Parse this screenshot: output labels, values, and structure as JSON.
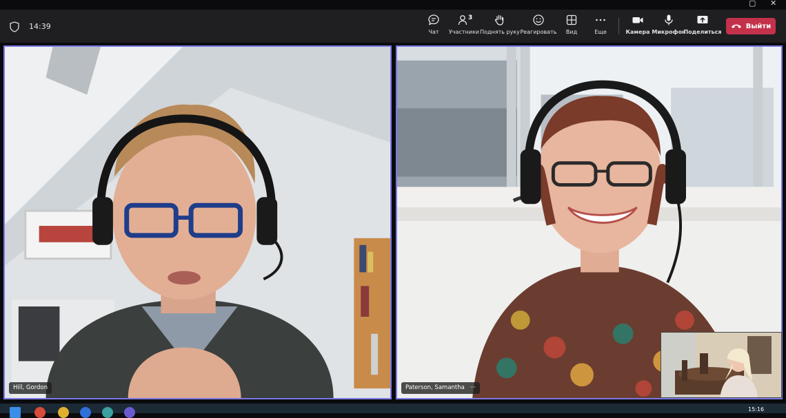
{
  "meeting": {
    "elapsed_time": "14:39"
  },
  "toolbar": {
    "chat_label": "Чат",
    "participants_label": "Участники",
    "participants_count": "3",
    "raise_hand_label": "Поднять руку",
    "react_label": "Реагировать",
    "view_label": "Вид",
    "more_label": "Еще",
    "camera_label": "Камера",
    "mic_label": "Микрофон",
    "share_label": "Поделиться",
    "leave_label": "Выйти",
    "leave_color": "#c4314b"
  },
  "participants": {
    "left_name": "Hill, Gordon",
    "right_name": "Paterson, Samantha",
    "tile_border_color": "#7a78e6"
  },
  "taskbar": {
    "clock": "15:16"
  },
  "icons": {
    "shield": "shield-icon",
    "chat": "chat-icon",
    "participants": "people-icon",
    "raise_hand": "hand-icon",
    "react": "smiley-icon",
    "view": "grid-icon",
    "more": "ellipsis-icon",
    "camera": "camera-icon",
    "mic": "mic-icon",
    "share": "share-icon",
    "leave": "phone-hangup-icon"
  }
}
